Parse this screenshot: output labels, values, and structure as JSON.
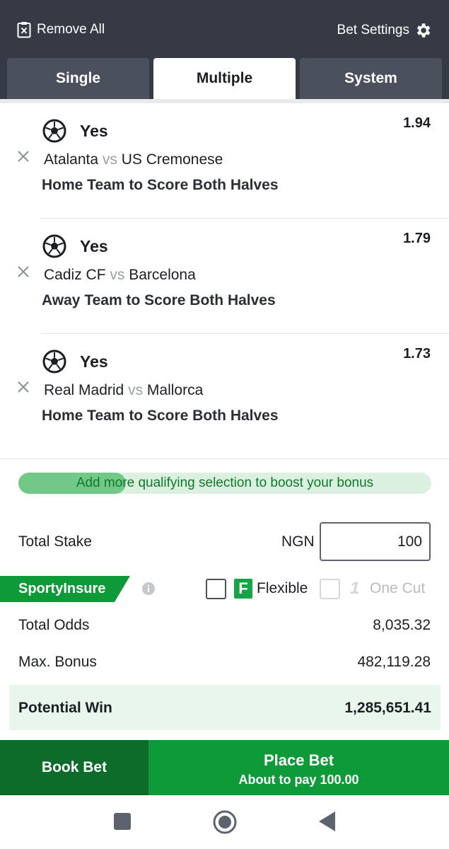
{
  "header": {
    "remove_all": "Remove All",
    "bet_settings": "Bet Settings",
    "remove_icon": "clipboard-x-icon",
    "settings_icon": "gear-icon"
  },
  "tabs": [
    {
      "label": "Single",
      "active": false
    },
    {
      "label": "Multiple",
      "active": true
    },
    {
      "label": "System",
      "active": false
    }
  ],
  "selections": [
    {
      "pick": "Yes",
      "odds": "1.94",
      "home": "Atalanta",
      "vs": "vs",
      "away": "US Cremonese",
      "market": "Home Team to Score Both Halves",
      "icon": "soccer-ball-icon"
    },
    {
      "pick": "Yes",
      "odds": "1.79",
      "home": "Cadiz CF",
      "vs": "vs",
      "away": "Barcelona",
      "market": "Away Team to Score Both Halves",
      "icon": "soccer-ball-icon"
    },
    {
      "pick": "Yes",
      "odds": "1.73",
      "home": "Real Madrid",
      "vs": "vs",
      "away": "Mallorca",
      "market": "Home Team to Score Both Halves",
      "icon": "soccer-ball-icon"
    }
  ],
  "bonus": {
    "text": "Add more qualifying selection to boost your bonus",
    "progress": 0.26
  },
  "stake": {
    "label": "Total Stake",
    "currency": "NGN",
    "value": "100"
  },
  "insure": {
    "label": "SportyInsure",
    "flexible_label": "Flexible",
    "flexible_logo": "F",
    "flexible_checked": false,
    "onecut_label": "One Cut",
    "onecut_logo": "1",
    "onecut_enabled": false
  },
  "summary": {
    "total_odds_label": "Total Odds",
    "total_odds": "8,035.32",
    "max_bonus_label": "Max. Bonus",
    "max_bonus": "482,119.28",
    "potential_win_label": "Potential Win",
    "potential_win": "1,285,651.41"
  },
  "actions": {
    "book_bet": "Book Bet",
    "place_bet": "Place Bet",
    "about_to_pay": "About to pay 100.00"
  },
  "colors": {
    "header_bg": "#353a45",
    "brand_green": "#0f9a39",
    "dark_green": "#0e6c2a"
  }
}
